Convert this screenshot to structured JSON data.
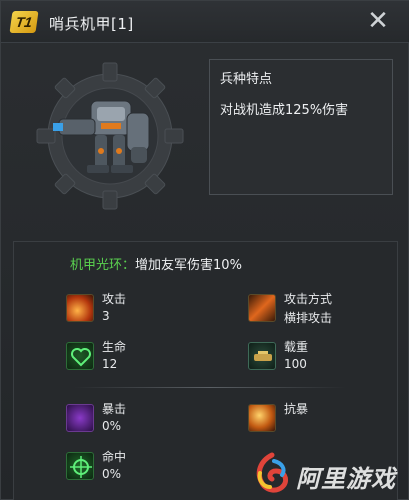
{
  "header": {
    "tier_badge": "T1",
    "title": "哨兵机甲[1]",
    "close_label": "✕"
  },
  "info": {
    "title": "兵种特点",
    "description": "对战机造成125%伤害"
  },
  "aura": {
    "label": "机甲光环",
    "separator": "：",
    "value": "增加友军伤害10%"
  },
  "stats": {
    "attack": {
      "label": "攻击",
      "value": "3",
      "icon": "attack-icon"
    },
    "attack_mode": {
      "label": "攻击方式",
      "value": "横排攻击",
      "icon": "attack-mode-icon"
    },
    "life": {
      "label": "生命",
      "value": "12",
      "icon": "heart-icon"
    },
    "load": {
      "label": "载重",
      "value": "100",
      "icon": "cargo-icon"
    },
    "crit": {
      "label": "暴击",
      "value": "0%",
      "icon": "crit-icon"
    },
    "resist": {
      "label": "抗暴",
      "value": "",
      "icon": "crit-resist-icon"
    },
    "hit": {
      "label": "命中",
      "value": "0%",
      "icon": "crosshair-icon"
    }
  },
  "watermark": {
    "text": "阿里游戏"
  },
  "colors": {
    "aura_green": "#5ad14f",
    "badge_gold": "#f4d34a"
  }
}
